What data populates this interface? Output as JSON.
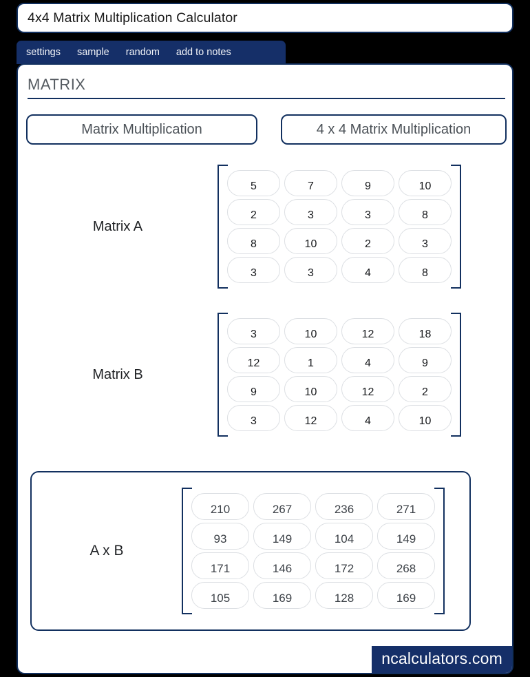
{
  "window": {
    "title": "4x4 Matrix Multiplication Calculator"
  },
  "nav": {
    "items": [
      {
        "label": "settings"
      },
      {
        "label": "sample"
      },
      {
        "label": "random"
      },
      {
        "label": "add to notes"
      }
    ]
  },
  "section": {
    "heading": "MATRIX"
  },
  "mode_buttons": {
    "primary": "Matrix Multiplication",
    "secondary": "4 x 4 Matrix Multiplication"
  },
  "matrix_a": {
    "label": "Matrix A",
    "rows": [
      [
        "5",
        "7",
        "9",
        "10"
      ],
      [
        "2",
        "3",
        "3",
        "8"
      ],
      [
        "8",
        "10",
        "2",
        "3"
      ],
      [
        "3",
        "3",
        "4",
        "8"
      ]
    ]
  },
  "matrix_b": {
    "label": "Matrix B",
    "rows": [
      [
        "3",
        "10",
        "12",
        "18"
      ],
      [
        "12",
        "1",
        "4",
        "9"
      ],
      [
        "9",
        "10",
        "12",
        "2"
      ],
      [
        "3",
        "12",
        "4",
        "10"
      ]
    ]
  },
  "result": {
    "label": "A x B",
    "rows": [
      [
        "210",
        "267",
        "236",
        "271"
      ],
      [
        "93",
        "149",
        "104",
        "149"
      ],
      [
        "171",
        "146",
        "172",
        "268"
      ],
      [
        "105",
        "169",
        "128",
        "169"
      ]
    ]
  },
  "footer": {
    "watermark": "ncalculators.com"
  },
  "colors": {
    "navy": "#12305f",
    "nav_bg": "#152f68",
    "page_bg": "#000000",
    "card_bg": "#ffffff",
    "cell_border": "#dcdfe3"
  }
}
